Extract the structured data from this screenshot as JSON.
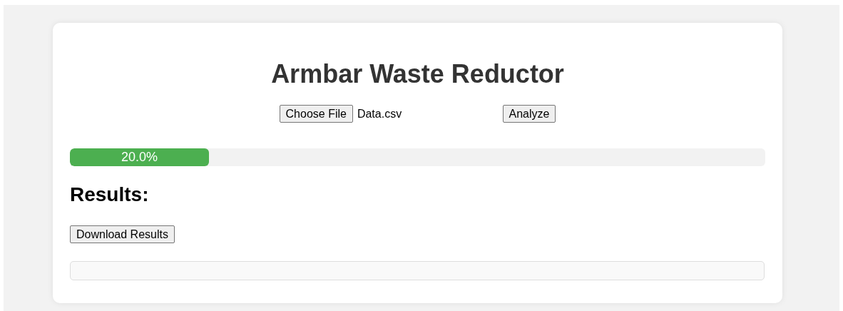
{
  "title": "Armbar Waste Reductor",
  "file_input": {
    "button_label": "Choose File",
    "file_name": "Data.csv"
  },
  "analyze_button": "Analyze",
  "progress": {
    "level": 0.2,
    "label": "20.0%"
  },
  "results_heading": "Results:",
  "download_button": "Download Results"
}
